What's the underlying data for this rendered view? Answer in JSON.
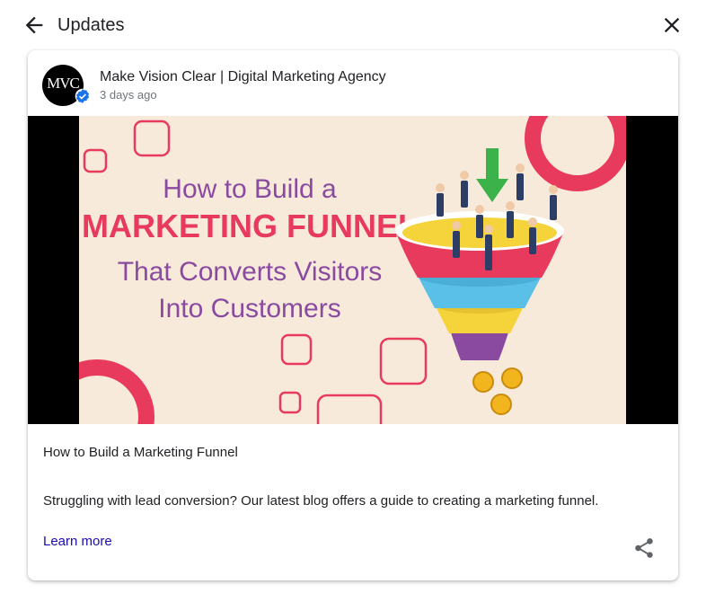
{
  "header": {
    "title": "Updates",
    "back_icon": "arrow-left-icon",
    "close_icon": "close-icon"
  },
  "post": {
    "avatar_text": "MVC",
    "author": "Make Vision Clear | Digital Marketing Agency",
    "verified_icon": "verified-badge-icon",
    "time": "3 days ago",
    "image": {
      "line1": "How to Build a",
      "line2": "MARKETING FUNNEL",
      "line3": "That Converts Visitors",
      "line4": "Into Customers"
    },
    "title": "How to Build a Marketing Funnel",
    "body": "Struggling with lead conversion? Our latest blog offers a guide to creating a marketing funnel.",
    "link": "Learn more",
    "share_icon": "share-icon"
  },
  "colors": {
    "link": "#1a0dab",
    "accent_pink": "#e83a5c",
    "headline_purple": "#8a4aa0",
    "verified_blue": "#1a73e8"
  }
}
